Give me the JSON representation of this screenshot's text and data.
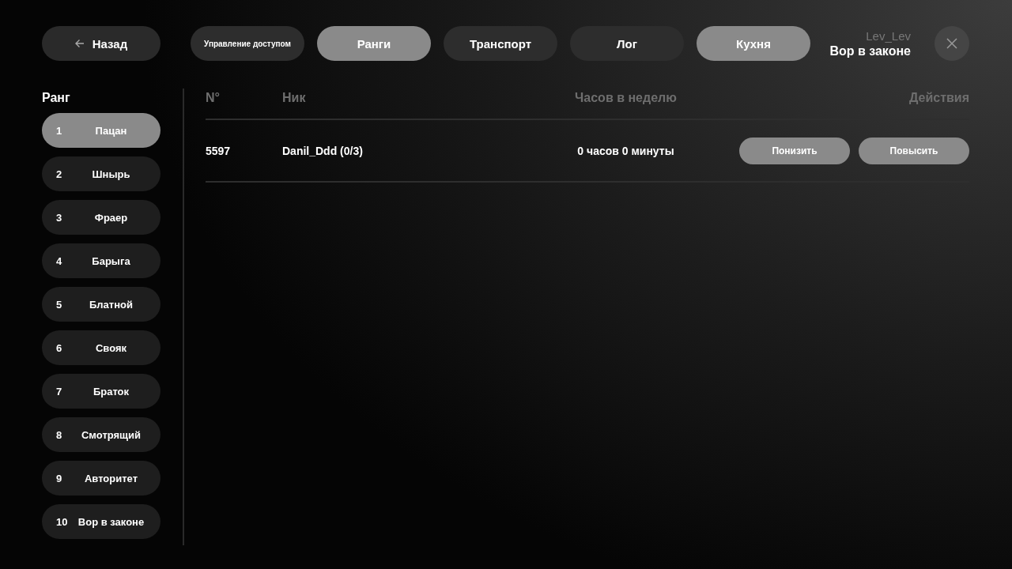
{
  "back_button": {
    "label": "Назад"
  },
  "tabs": [
    {
      "label": "Управление доступом",
      "kind": "small",
      "selected": false
    },
    {
      "label": "Ранги",
      "kind": "normal",
      "selected": true
    },
    {
      "label": "Транспорт",
      "kind": "normal",
      "selected": false
    },
    {
      "label": "Лог",
      "kind": "normal",
      "selected": false
    },
    {
      "label": "Кухня",
      "kind": "normal",
      "selected": true
    }
  ],
  "user": {
    "name": "Lev_Lev",
    "rank": "Вор в законе"
  },
  "sidebar": {
    "title": "Ранг",
    "items": [
      {
        "number": "1",
        "label": "Пацан",
        "selected": true
      },
      {
        "number": "2",
        "label": "Шнырь",
        "selected": false
      },
      {
        "number": "3",
        "label": "Фраер",
        "selected": false
      },
      {
        "number": "4",
        "label": "Барыга",
        "selected": false
      },
      {
        "number": "5",
        "label": "Блатной",
        "selected": false
      },
      {
        "number": "6",
        "label": "Свояк",
        "selected": false
      },
      {
        "number": "7",
        "label": "Браток",
        "selected": false
      },
      {
        "number": "8",
        "label": "Смотрящий",
        "selected": false
      },
      {
        "number": "9",
        "label": "Авторитет",
        "selected": false
      },
      {
        "number": "10",
        "label": "Вор в законе",
        "selected": false
      }
    ]
  },
  "table": {
    "columns": [
      "N°",
      "Ник",
      "Часов в неделю",
      "Действия"
    ],
    "rows": [
      {
        "number": "5597",
        "nick": "Danil_Ddd (0/3)",
        "hours": "0 часов 0 минуты",
        "actions": [
          "Понизить",
          "Повысить"
        ]
      }
    ]
  }
}
